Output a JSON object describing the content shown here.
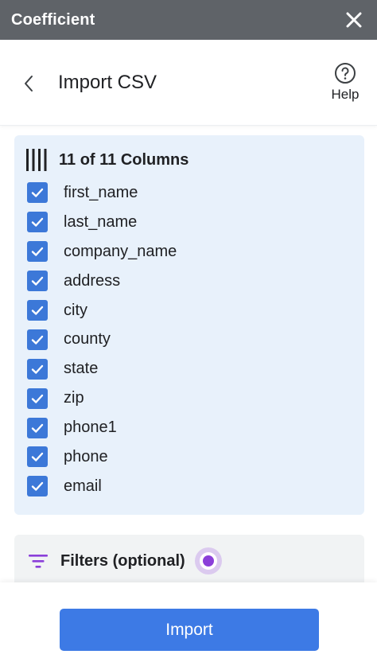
{
  "app": {
    "title": "Coefficient"
  },
  "header": {
    "title": "Import CSV",
    "help_label": "Help"
  },
  "columns": {
    "summary": "11 of 11 Columns",
    "items": [
      {
        "label": "first_name",
        "checked": true
      },
      {
        "label": "last_name",
        "checked": true
      },
      {
        "label": "company_name",
        "checked": true
      },
      {
        "label": "address",
        "checked": true
      },
      {
        "label": "city",
        "checked": true
      },
      {
        "label": "county",
        "checked": true
      },
      {
        "label": "state",
        "checked": true
      },
      {
        "label": "zip",
        "checked": true
      },
      {
        "label": "phone1",
        "checked": true
      },
      {
        "label": "phone",
        "checked": true
      },
      {
        "label": "email",
        "checked": true
      }
    ]
  },
  "filters": {
    "label": "Filters (optional)"
  },
  "footer": {
    "import_label": "Import"
  },
  "colors": {
    "titlebar": "#5f6368",
    "panel_bg": "#e8f1fb",
    "checkbox": "#3c78d8",
    "accent_purple": "#8b3fd9",
    "import_button": "#3d7ae5"
  },
  "icons": {
    "close": "close-icon",
    "back": "chevron-left-icon",
    "help": "help-circle-icon",
    "columns": "columns-icon",
    "checkbox": "checkmark-icon",
    "filters": "filter-icon"
  }
}
